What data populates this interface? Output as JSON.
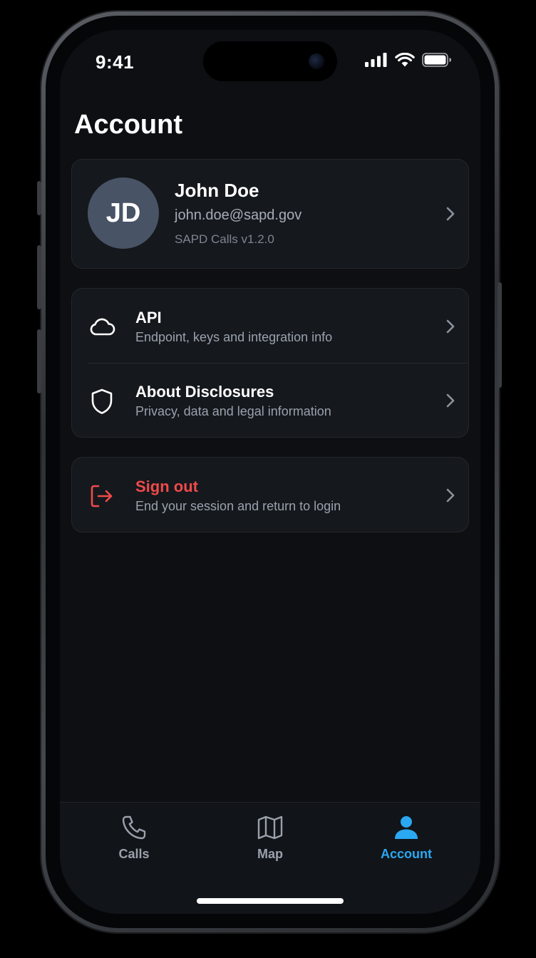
{
  "status_bar": {
    "time": "9:41"
  },
  "page": {
    "title": "Account"
  },
  "profile": {
    "initials": "JD",
    "name": "John Doe",
    "email": "john.doe@sapd.gov",
    "version": "SAPD Calls v1.2.0"
  },
  "menu": {
    "items": [
      {
        "title": "API",
        "subtitle": "Endpoint, keys and integration info",
        "icon": "cloud-icon"
      },
      {
        "title": "About Disclosures",
        "subtitle": "Privacy, data and legal information",
        "icon": "shield-icon"
      }
    ]
  },
  "signout": {
    "title": "Sign out",
    "subtitle": "End your session and return to login",
    "icon": "logout-icon"
  },
  "tabbar": {
    "tabs": [
      {
        "label": "Calls",
        "icon": "phone-icon",
        "active": false
      },
      {
        "label": "Map",
        "icon": "map-icon",
        "active": false
      },
      {
        "label": "Account",
        "icon": "user-icon",
        "active": true
      }
    ]
  },
  "colors": {
    "background": "#0d0f12",
    "card": "#15181c",
    "accent": "#2aa8f2",
    "danger": "#ef4a4a",
    "avatar": "#485365"
  }
}
